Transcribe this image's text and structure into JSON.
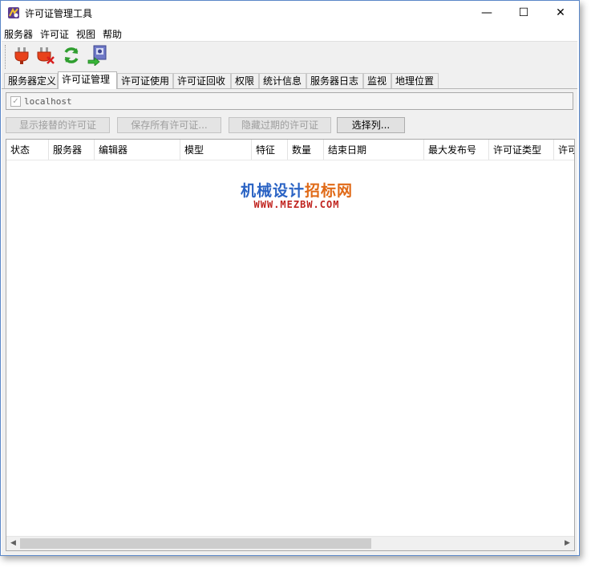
{
  "window": {
    "title": "许可证管理工具",
    "minimize_glyph": "—",
    "maximize_glyph": "☐",
    "close_glyph": "✕"
  },
  "menu": [
    "服务器",
    "许可证",
    "视图",
    "帮助"
  ],
  "toolbar": {
    "icons": [
      "connect-plug-icon",
      "disconnect-plug-icon",
      "refresh-icon",
      "export-icon"
    ]
  },
  "tabs": [
    "服务器定义",
    "许可证管理",
    "许可证使用",
    "许可证回收",
    "权限",
    "统计信息",
    "服务器日志",
    "监视",
    "地理位置"
  ],
  "active_tab": "许可证管理",
  "server": {
    "checked": true,
    "check_glyph": "✓",
    "name": "localhost"
  },
  "actions": {
    "show_replaced": "显示接替的许可证",
    "save_all": "保存所有许可证...",
    "hide_expired": "隐藏过期的许可证",
    "choose_columns": "选择列..."
  },
  "table": {
    "columns": [
      "状态",
      "服务器",
      "编辑器",
      "模型",
      "特征",
      "数量",
      "结束日期",
      "最大发布号",
      "许可证类型",
      "许可证"
    ],
    "rows": []
  },
  "scrollbar": {
    "left_arrow": "◀",
    "right_arrow": "▶"
  },
  "watermark": {
    "line1_part1": "机械设计",
    "line1_part2": "招标网",
    "line2": "WWW.MEZBW.COM"
  },
  "colors": {
    "accent_blue": "#2a63c4",
    "accent_orange": "#e06a17",
    "watermark_red": "#c0241f",
    "window_border": "#5a87c8"
  }
}
